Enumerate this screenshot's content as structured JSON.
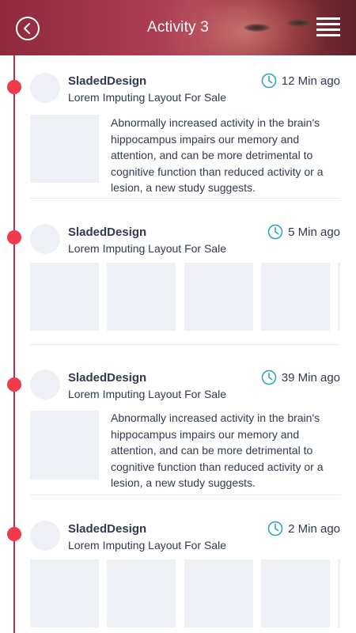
{
  "header": {
    "title": "Activity 3",
    "back_icon": "chevron-left-circle-icon",
    "menu_icon": "hamburger-menu-icon"
  },
  "colors": {
    "accent_red": "#ef3b4c",
    "timeline": "#c0304a",
    "clock_teal": "#2aa5c0",
    "text_dark": "#2f3b4f",
    "placeholder": "#edf0f5"
  },
  "posts": [
    {
      "author": "SladedDesign",
      "subtitle": "Lorem Imputing Layout For Sale",
      "time": "12 Min ago",
      "text": "Abnormally increased activity in the brain's hippocampus impairs our memory and attention, and can be more detrimental to cognitive function than reduced activity or a lesion, a new study suggests."
    },
    {
      "author": "SladedDesign",
      "subtitle": "Lorem Imputing Layout For Sale",
      "time": "5 Min ago"
    },
    {
      "author": "SladedDesign",
      "subtitle": "Lorem Imputing Layout For Sale",
      "time": "39 Min ago",
      "text": "Abnormally increased activity in the brain's hippocampus impairs our memory and attention, and can be more detrimental to cognitive function than reduced activity or a lesion, a new study suggests."
    },
    {
      "author": "SladedDesign",
      "subtitle": "Lorem Imputing Layout For Sale",
      "time": "2 Min ago"
    }
  ]
}
